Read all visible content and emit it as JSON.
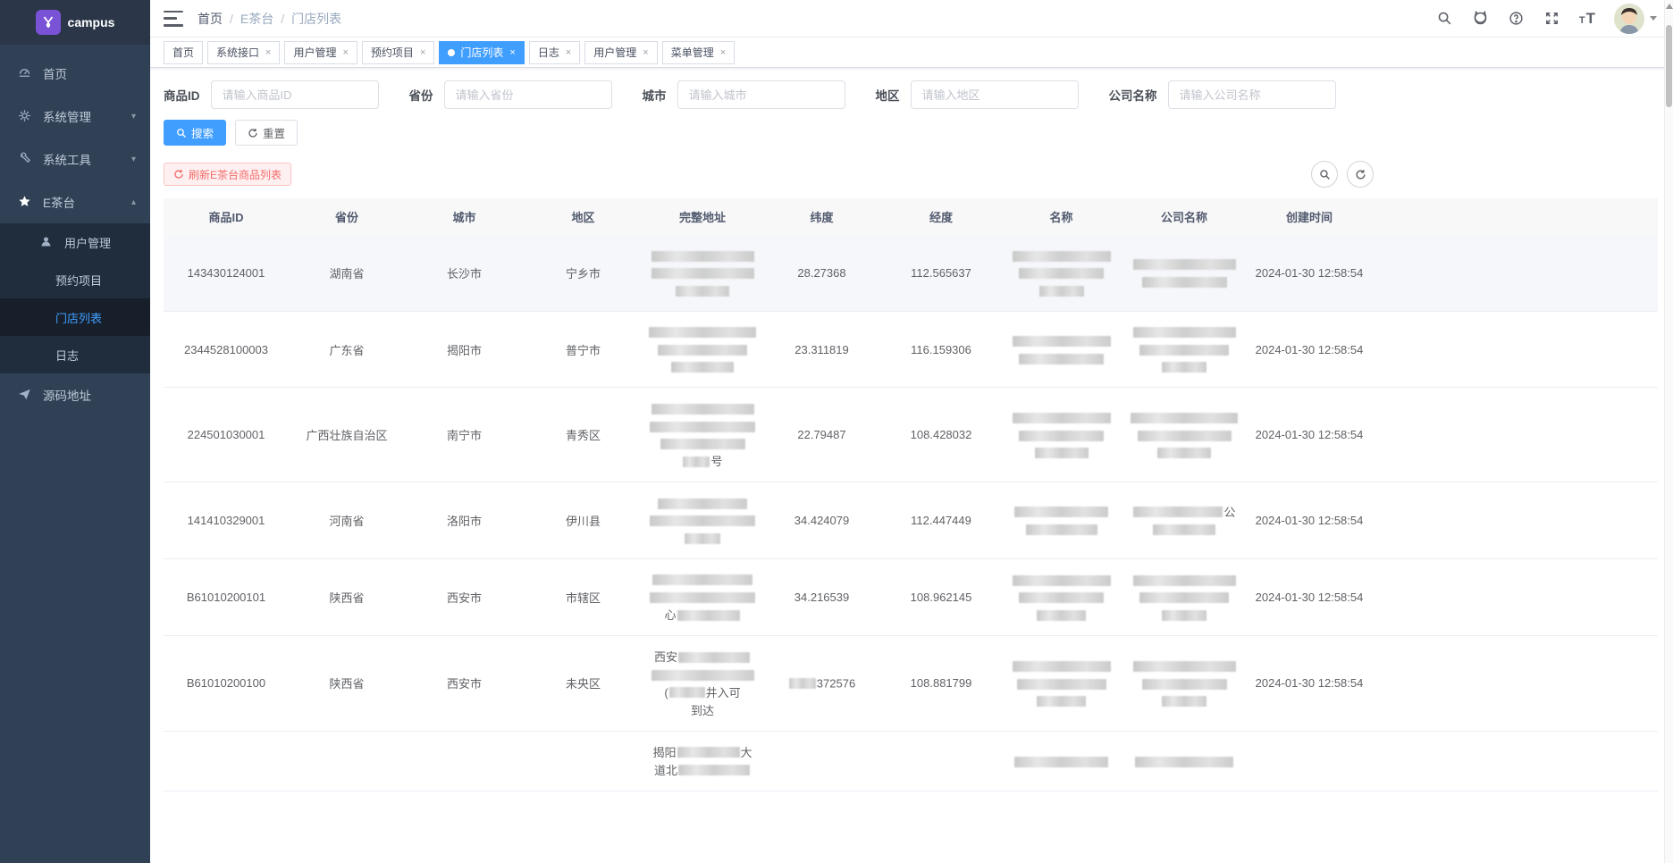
{
  "app": {
    "logo_text": "campus"
  },
  "sidebar": {
    "items": [
      {
        "label": "首页",
        "icon": "dashboard-icon"
      },
      {
        "label": "系统管理",
        "icon": "gear-icon",
        "expandable": true
      },
      {
        "label": "系统工具",
        "icon": "tools-icon",
        "expandable": true
      },
      {
        "label": "E茶台",
        "icon": "star-icon",
        "expandable": true,
        "expanded": true,
        "children": [
          {
            "label": "用户管理",
            "icon": "user-icon"
          },
          {
            "label": "预约项目"
          },
          {
            "label": "门店列表",
            "active": true
          },
          {
            "label": "日志"
          }
        ]
      },
      {
        "label": "源码地址",
        "icon": "send-icon"
      }
    ]
  },
  "navbar": {
    "breadcrumb": [
      "首页",
      "E茶台",
      "门店列表"
    ],
    "breadcrumb_separator": "/"
  },
  "tags": [
    {
      "label": "首页",
      "closable": false
    },
    {
      "label": "系统接口",
      "closable": true
    },
    {
      "label": "用户管理",
      "closable": true
    },
    {
      "label": "预约项目",
      "closable": true
    },
    {
      "label": "门店列表",
      "closable": true,
      "active": true
    },
    {
      "label": "日志",
      "closable": true
    },
    {
      "label": "用户管理",
      "closable": true
    },
    {
      "label": "菜单管理",
      "closable": true
    }
  ],
  "form": {
    "fields": [
      {
        "label": "商品ID",
        "placeholder": "请输入商品ID"
      },
      {
        "label": "省份",
        "placeholder": "请输入省份"
      },
      {
        "label": "城市",
        "placeholder": "请输入城市"
      },
      {
        "label": "地区",
        "placeholder": "请输入地区"
      },
      {
        "label": "公司名称",
        "placeholder": "请输入公司名称"
      }
    ],
    "search_label": "搜索",
    "reset_label": "重置"
  },
  "toolbar": {
    "refresh_list_label": "刷新E茶台商品列表"
  },
  "table": {
    "headers": [
      "商品ID",
      "省份",
      "城市",
      "地区",
      "完整地址",
      "纬度",
      "经度",
      "名称",
      "公司名称",
      "创建时间"
    ],
    "rows": [
      {
        "id": "143430124001",
        "province": "湖南省",
        "city": "长沙市",
        "district": "宁乡市",
        "lat": "28.27368",
        "lng": "112.565637",
        "created": "2024-01-30 12:58:54"
      },
      {
        "id": "2344528100003",
        "province": "广东省",
        "city": "揭阳市",
        "district": "普宁市",
        "lat": "23.311819",
        "lng": "116.159306",
        "created": "2024-01-30 12:58:54"
      },
      {
        "id": "224501030001",
        "province": "广西壮族自治区",
        "city": "南宁市",
        "district": "青秀区",
        "lat": "22.79487",
        "lng": "108.428032",
        "created": "2024-01-30 12:58:54",
        "address_fragment": "号"
      },
      {
        "id": "141410329001",
        "province": "河南省",
        "city": "洛阳市",
        "district": "伊川县",
        "lat": "34.424079",
        "lng": "112.447449",
        "created": "2024-01-30 12:58:54",
        "company_fragment": "公"
      },
      {
        "id": "B61010200101",
        "province": "陕西省",
        "city": "西安市",
        "district": "市辖区",
        "lat": "34.216539",
        "lng": "108.962145",
        "created": "2024-01-30 12:58:54",
        "address_fragment": "心"
      },
      {
        "id": "B61010200100",
        "province": "陕西省",
        "city": "西安市",
        "district": "未央区",
        "lat_visible": "372576",
        "lng": "108.881799",
        "created": "2024-01-30 12:58:54",
        "address_fragments": {
          "l1": "西安",
          "l3a": "(",
          "l3b": "井入可",
          "l4": "到达"
        }
      },
      {
        "id": "",
        "province": "",
        "city": "",
        "district": "",
        "lng": "",
        "created": "",
        "address_fragments": {
          "l1a": "揭阳",
          "l1b": "大",
          "l2": "道北"
        }
      }
    ]
  }
}
